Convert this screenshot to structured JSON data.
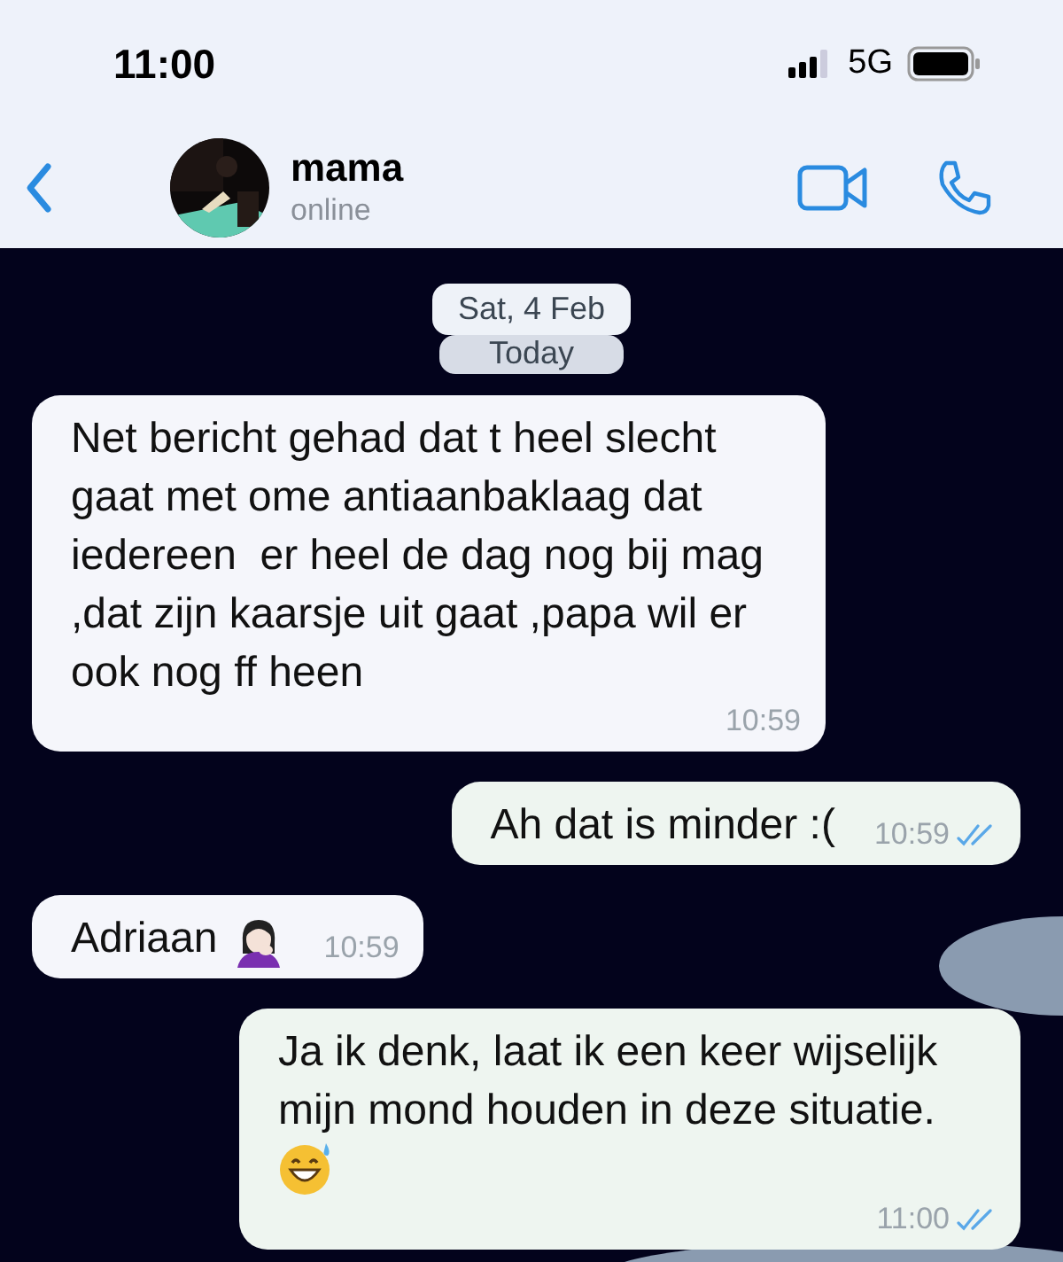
{
  "status_bar": {
    "time": "11:00",
    "network": "5G"
  },
  "header": {
    "name": "mama",
    "status": "online"
  },
  "date_chips": [
    "Sat, 4 Feb",
    "Today"
  ],
  "messages": [
    {
      "kind": "received",
      "parts": [
        {
          "kind": "text",
          "text": "Net bericht gehad dat t heel slecht gaat met ome antiaanbaklaag dat iedereen  er heel de dag nog bij mag ,dat zijn kaarsje uit gaat ,papa wil er ook nog ff heen"
        }
      ],
      "time": "10:59"
    },
    {
      "kind": "sent",
      "parts": [
        {
          "kind": "text",
          "text": "Ah dat is minder :("
        }
      ],
      "time": "10:59",
      "read": true
    },
    {
      "kind": "received",
      "parts": [
        {
          "kind": "text",
          "text": "Adriaan"
        },
        {
          "kind": "person"
        }
      ],
      "time": "10:59"
    },
    {
      "kind": "sent",
      "parts": [
        {
          "kind": "text",
          "text": "Ja ik denk, laat ik een keer wijselijk mijn mond houden in deze situatie."
        },
        {
          "kind": "smiley"
        }
      ],
      "time": "11:00",
      "read": true
    }
  ]
}
